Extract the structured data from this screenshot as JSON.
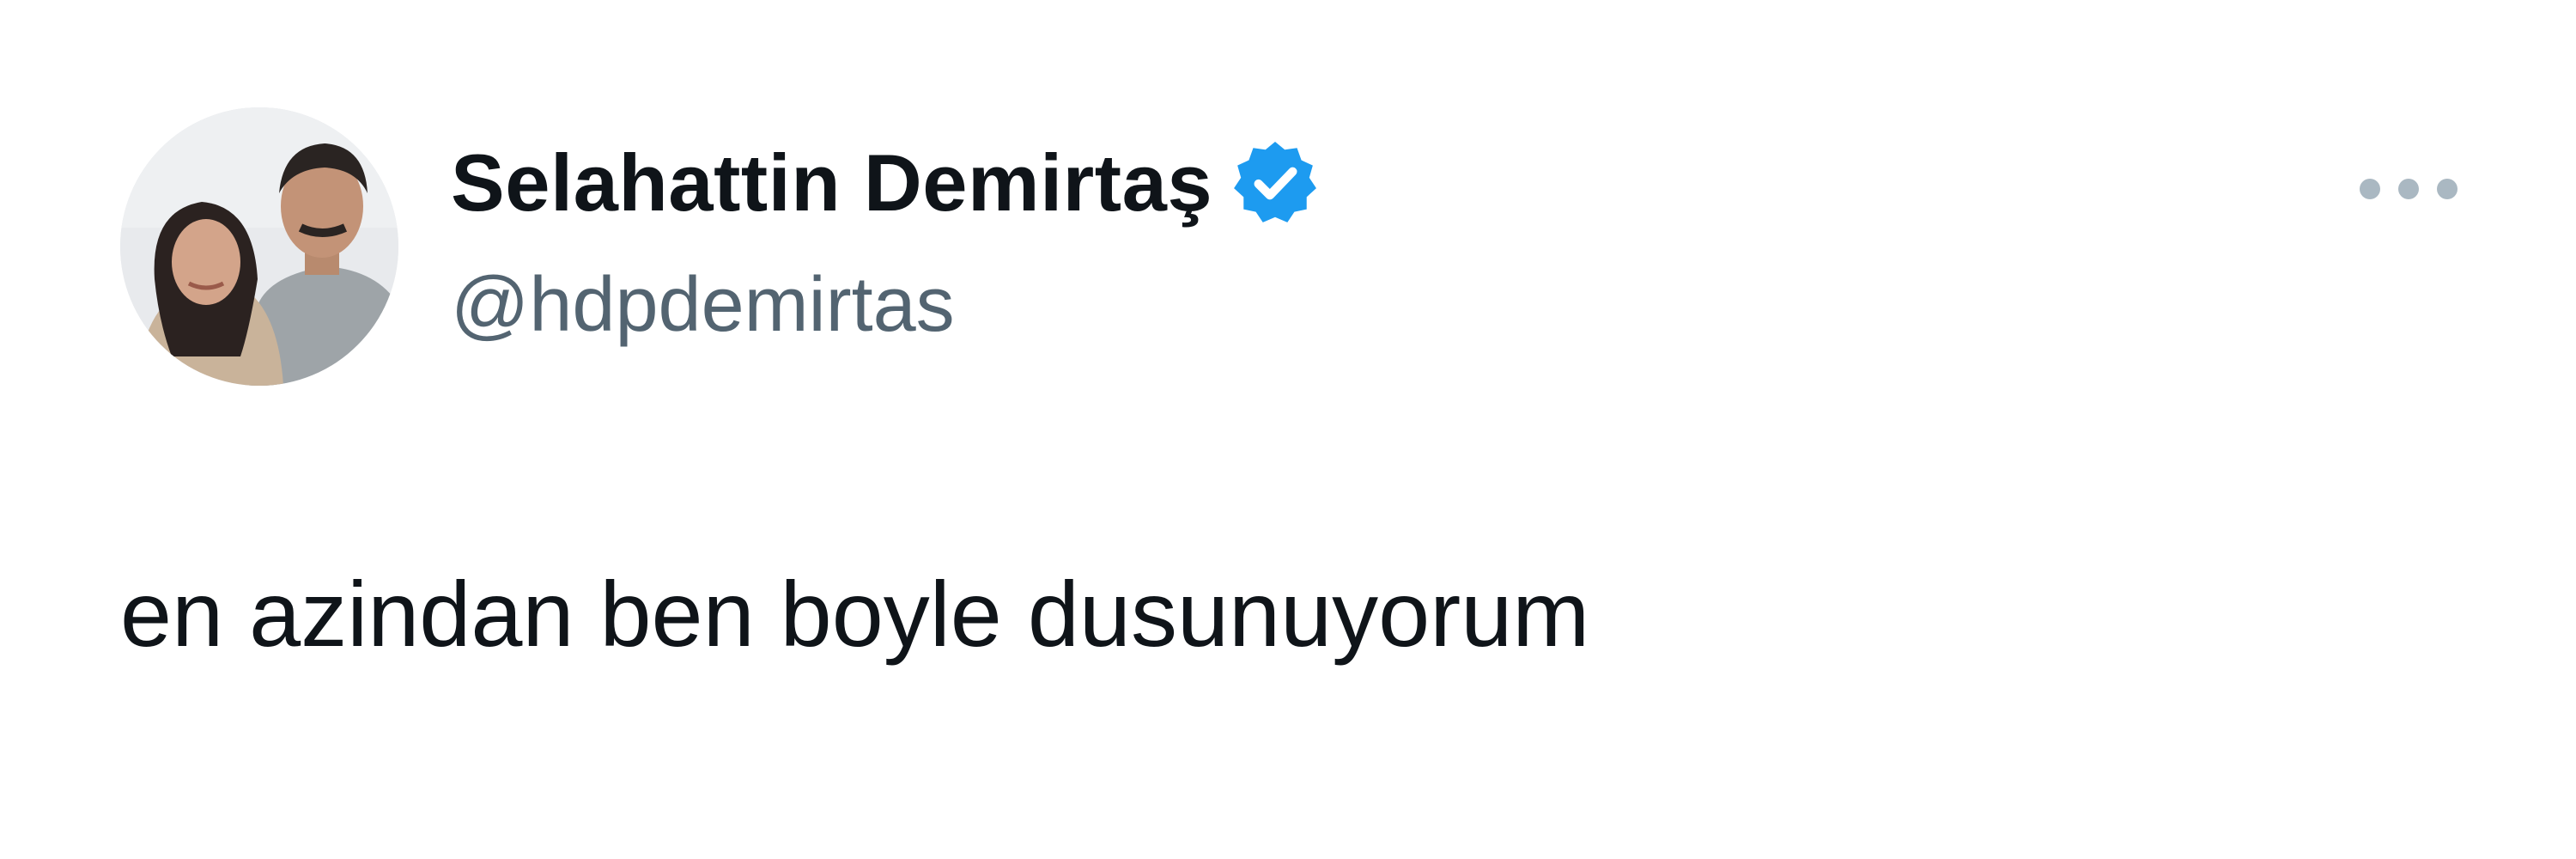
{
  "tweet": {
    "author": {
      "display_name": "Selahattin Demirtaş",
      "handle": "@hdpdemirtas",
      "verified": true,
      "avatar_icon": "profile-photo"
    },
    "text": "en azindan ben boyle dusunuyorum",
    "more_icon": "more-horizontal-icon"
  },
  "colors": {
    "background": "#ffffff",
    "name_text": "#0f1419",
    "handle_text": "#536471",
    "verified_blue": "#1d9bf0",
    "more_dots": "#aab8c2"
  }
}
